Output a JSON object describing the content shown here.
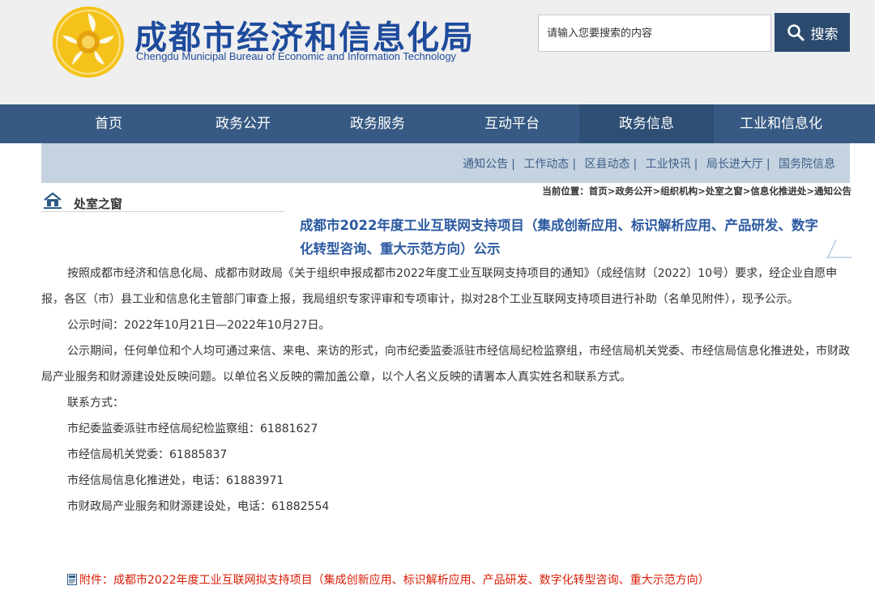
{
  "header": {
    "title_cn": "成都市经济和信息化局",
    "title_en": "Chengdu Municipal Bureau of Economic and Information Technology",
    "search_placeholder": "请输入您要搜索的内容",
    "search_button": "搜索",
    "brand_color": "#1e4b9c"
  },
  "nav": {
    "items": [
      "首页",
      "政务公开",
      "政务服务",
      "互动平台",
      "政务信息",
      "工业和信息化"
    ],
    "active": "政务信息"
  },
  "subnav": {
    "items": [
      "通知公告",
      "工作动态",
      "区县动态",
      "工业快讯",
      "局长进大厅",
      "国务院信息"
    ]
  },
  "section": {
    "title": "处室之窗"
  },
  "breadcrumb": {
    "label": "当前位置：",
    "items": [
      "首页",
      "政务公开",
      "组织机构",
      "处室之窗",
      "信息化推进处",
      "通知公告"
    ]
  },
  "article": {
    "title": "成都市2022年度工业互联网支持项目（集成创新应用、标识解析应用、产品研发、数字化转型咨询、重大示范方向）公示",
    "paragraphs": [
      "按照成都市经济和信息化局、成都市财政局《关于组织申报成都市2022年度工业互联网支持项目的通知》（成经信财〔2022〕10号）要求，经企业自愿申报，各区（市）县工业和信息化主管部门审查上报，我局组织专家评审和专项审计，拟对28个工业互联网支持项目进行补助（名单见附件），现予公示。",
      "公示时间：2022年10月21日—2022年10月27日。",
      "公示期间，任何单位和个人均可通过来信、来电、来访的形式，向市纪委监委派驻市经信局纪检监察组，市经信局机关党委、市经信局信息化推进处，市财政局产业服务和财源建设处反映问题。以单位名义反映的需加盖公章，以个人名义反映的请署本人真实姓名和联系方式。"
    ],
    "contacts_label": "联系方式：",
    "contacts": [
      "市纪委监委派驻市经信局纪检监察组：61881627",
      "市经信局机关党委：61885837",
      "市经信局信息化推进处，电话：61883971",
      "市财政局产业服务和财源建设处，电话：61882554"
    ],
    "attachment": "附件：成都市2022年度工业互联网拟支持项目（集成创新应用、标识解析应用、产品研发、数字化转型咨询、重大示范方向）"
  }
}
